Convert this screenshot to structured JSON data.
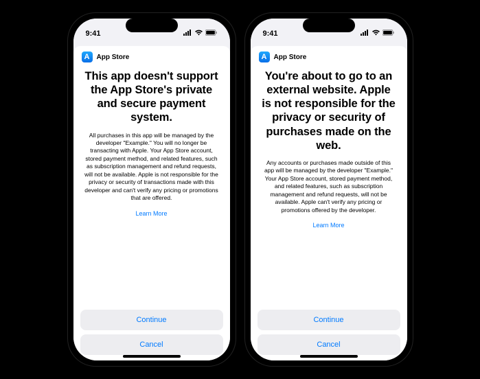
{
  "status": {
    "time": "9:41"
  },
  "sheet_title": "App Store",
  "learn_more": "Learn More",
  "continue_label": "Continue",
  "cancel_label": "Cancel",
  "phones": [
    {
      "headline": "This app doesn't support the App Store's private and secure payment system.",
      "body": "All purchases in this app will be managed by the developer \"Example.\" You will no longer be transacting with Apple. Your App Store account, stored payment method, and related features, such as subscription management and refund requests, will not be available. Apple is not responsible for the privacy or security of transactions made with this developer and can't verify any pricing or promotions that are offered."
    },
    {
      "headline": "You're about to go to an external website. Apple is not responsible for the privacy or security of purchases made on the web.",
      "body": "Any accounts or purchases made outside of this app will be managed by the developer \"Example.\" Your App Store account, stored payment method, and related features, such as subscription management and refund requests, will not be available. Apple can't verify any pricing or promotions offered by the developer."
    }
  ]
}
